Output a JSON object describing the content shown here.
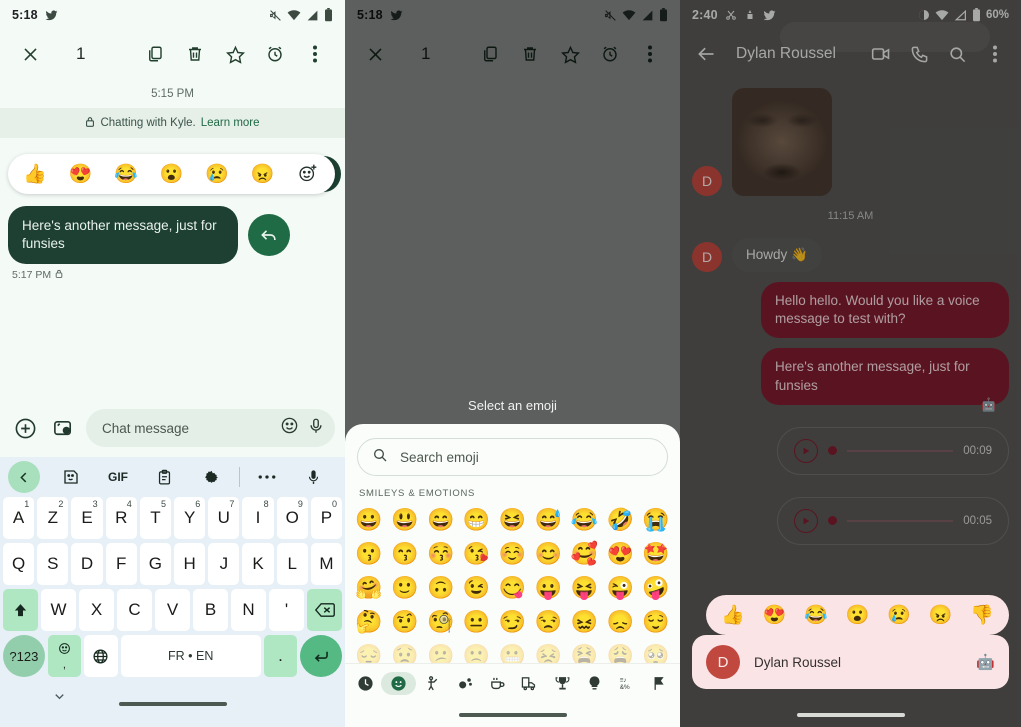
{
  "panel1": {
    "status": {
      "time": "5:18",
      "icons": [
        "twitter-bird",
        "mute",
        "wifi",
        "signal",
        "battery"
      ]
    },
    "appbar": {
      "close": "✕",
      "selection_count": "1",
      "actions": [
        "copy-icon",
        "delete-icon",
        "star-icon",
        "alarm-icon",
        "overflow-icon"
      ]
    },
    "conversation": {
      "daystamp": "5:15 PM",
      "e2e_text": "Chatting with Kyle.",
      "e2e_link": "Learn more",
      "reactions": [
        "👍",
        "😍",
        "😂",
        "😮",
        "😢",
        "😠"
      ],
      "message": "Here's another message, just for funsies",
      "message_time": "5:17 PM"
    },
    "composer": {
      "placeholder": "Chat message"
    },
    "keyboard": {
      "toolbar": [
        "back-icon",
        "sticker-icon",
        "GIF",
        "clipboard-icon",
        "settings-icon",
        "more-icon",
        "mic-icon"
      ],
      "gif_label": "GIF",
      "row1": [
        {
          "k": "A",
          "n": "1"
        },
        {
          "k": "Z",
          "n": "2"
        },
        {
          "k": "E",
          "n": "3"
        },
        {
          "k": "R",
          "n": "4"
        },
        {
          "k": "T",
          "n": "5"
        },
        {
          "k": "Y",
          "n": "6"
        },
        {
          "k": "U",
          "n": "7"
        },
        {
          "k": "I",
          "n": "8"
        },
        {
          "k": "O",
          "n": "9"
        },
        {
          "k": "P",
          "n": "0"
        }
      ],
      "row2": [
        "Q",
        "S",
        "D",
        "F",
        "G",
        "H",
        "J",
        "K",
        "L",
        "M"
      ],
      "row3": [
        "W",
        "X",
        "C",
        "V",
        "B",
        "N",
        "'"
      ],
      "numeric_key": "?123",
      "space_label": "FR • EN",
      "period_key": ".",
      "comma_key": ","
    }
  },
  "panel2": {
    "status": {
      "time": "5:18"
    },
    "appbar": {
      "selection_count": "1"
    },
    "sheet": {
      "title": "Select an emoji",
      "search_placeholder": "Search emoji",
      "category_label": "SMILEYS & EMOTIONS",
      "grid": [
        [
          "😀",
          "😃",
          "😄",
          "😁",
          "😆",
          "😅",
          "😂",
          "🤣",
          "😭"
        ],
        [
          "😗",
          "😙",
          "😚",
          "😘",
          "☺️",
          "😊",
          "🥰",
          "😍",
          "🤩"
        ],
        [
          "🤗",
          "🙂",
          "🙃",
          "😉",
          "😋",
          "😛",
          "😝",
          "😜",
          "🤪"
        ],
        [
          "🤔",
          "🤨",
          "🧐",
          "😐",
          "😏",
          "😒",
          "😖",
          "😞",
          "😌"
        ],
        [
          "😔",
          "😟",
          "😕",
          "🙁",
          "😬",
          "😣",
          "😫",
          "😩",
          "🥺"
        ]
      ],
      "tabs": [
        "recent-clock-icon",
        "smileys-icon",
        "people-icon",
        "nature-icon",
        "food-icon",
        "travel-icon",
        "activities-icon",
        "objects-icon",
        "symbols-icon",
        "flags-icon"
      ],
      "active_tab_index": 1
    }
  },
  "panel3": {
    "status": {
      "time": "2:40",
      "battery_text": "60%"
    },
    "appbar": {
      "title": "Dylan Roussel",
      "actions": [
        "video-call-icon",
        "phone-call-icon",
        "search-icon",
        "overflow-icon"
      ]
    },
    "conversation": {
      "avatar_letter": "D",
      "timestamp": "11:15 AM",
      "incoming_message": "Howdy 👋",
      "outgoing_1": "Hello hello. Would you like a voice message to test with?",
      "outgoing_2": "Here's another message, just for funsies",
      "voice_1_duration": "00:09",
      "voice_2_duration": "00:05"
    },
    "reactions": [
      "👍",
      "😍",
      "😂",
      "😮",
      "😢",
      "😠",
      "👎"
    ],
    "card": {
      "avatar_letter": "D",
      "name": "Dylan Roussel",
      "badge": "🤖"
    }
  },
  "colors": {
    "green_bubble": "#1d4032",
    "red_bubble": "#7d1c2e",
    "accent_green": "#1f6b45",
    "pink_surface": "#fbe4e6",
    "avatar_red": "#c0483f"
  }
}
